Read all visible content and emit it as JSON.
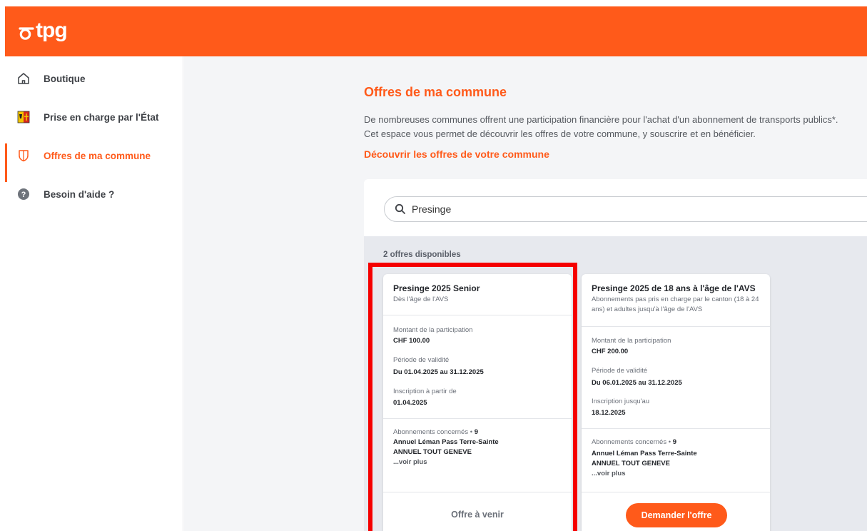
{
  "brand": {
    "logo_text": "tpg",
    "accent": "#ff5a1a",
    "highlight_color": "#f50000"
  },
  "sidebar": {
    "items": [
      {
        "label": "Boutique",
        "icon": "home-icon",
        "active": false
      },
      {
        "label": "Prise en charge par l'État",
        "icon": "geneva-flag-icon",
        "active": false
      },
      {
        "label": "Offres de ma commune",
        "icon": "shield-icon",
        "active": true
      },
      {
        "label": "Besoin d'aide ?",
        "icon": "help-icon",
        "active": false
      }
    ]
  },
  "main": {
    "title": "Offres de ma commune",
    "intro_line1": "De nombreuses communes offrent une participation financière pour l'achat d'un abonnement de transports publics*.",
    "intro_line2": "Cet espace vous permet de découvrir les offres de votre commune, y souscrire et en bénéficier.",
    "discover_heading": "Découvrir les offres de votre commune",
    "search": {
      "value": "Presinge",
      "icon": "search-icon"
    },
    "results_count": "2 offres disponibles"
  },
  "offers": [
    {
      "title": "Presinge 2025 Senior",
      "subtitle": "Dès l'âge de l'AVS",
      "amount_label": "Montant de la participation",
      "amount": "CHF 100.00",
      "validity_label": "Période de validité",
      "validity": "Du 01.04.2025 au 31.12.2025",
      "registration_label": "Inscription à partir de",
      "registration": "01.04.2025",
      "subscriptions_label": "Abonnements concernés",
      "subscriptions_count": "9",
      "subscription_1": "Annuel Léman Pass Terre-Sainte",
      "subscription_2": "ANNUEL TOUT GENEVE",
      "see_more": "...voir plus",
      "action": "Offre à venir"
    },
    {
      "title": "Presinge 2025 de 18 ans à l'âge de l'AVS",
      "subtitle": "Abonnements pas pris en charge par le canton (18 à 24 ans) et adultes jusqu'à l'âge de l'AVS",
      "amount_label": "Montant de la participation",
      "amount": "CHF 200.00",
      "validity_label": "Période de validité",
      "validity": "Du 06.01.2025 au 31.12.2025",
      "registration_label": "Inscription jusqu'au",
      "registration": "18.12.2025",
      "subscriptions_label": "Abonnements concernés",
      "subscriptions_count": "9",
      "subscription_1": "Annuel Léman Pass Terre-Sainte",
      "subscription_2": "ANNUEL TOUT GENEVE",
      "see_more": "...voir plus",
      "action": "Demander l'offre"
    }
  ]
}
